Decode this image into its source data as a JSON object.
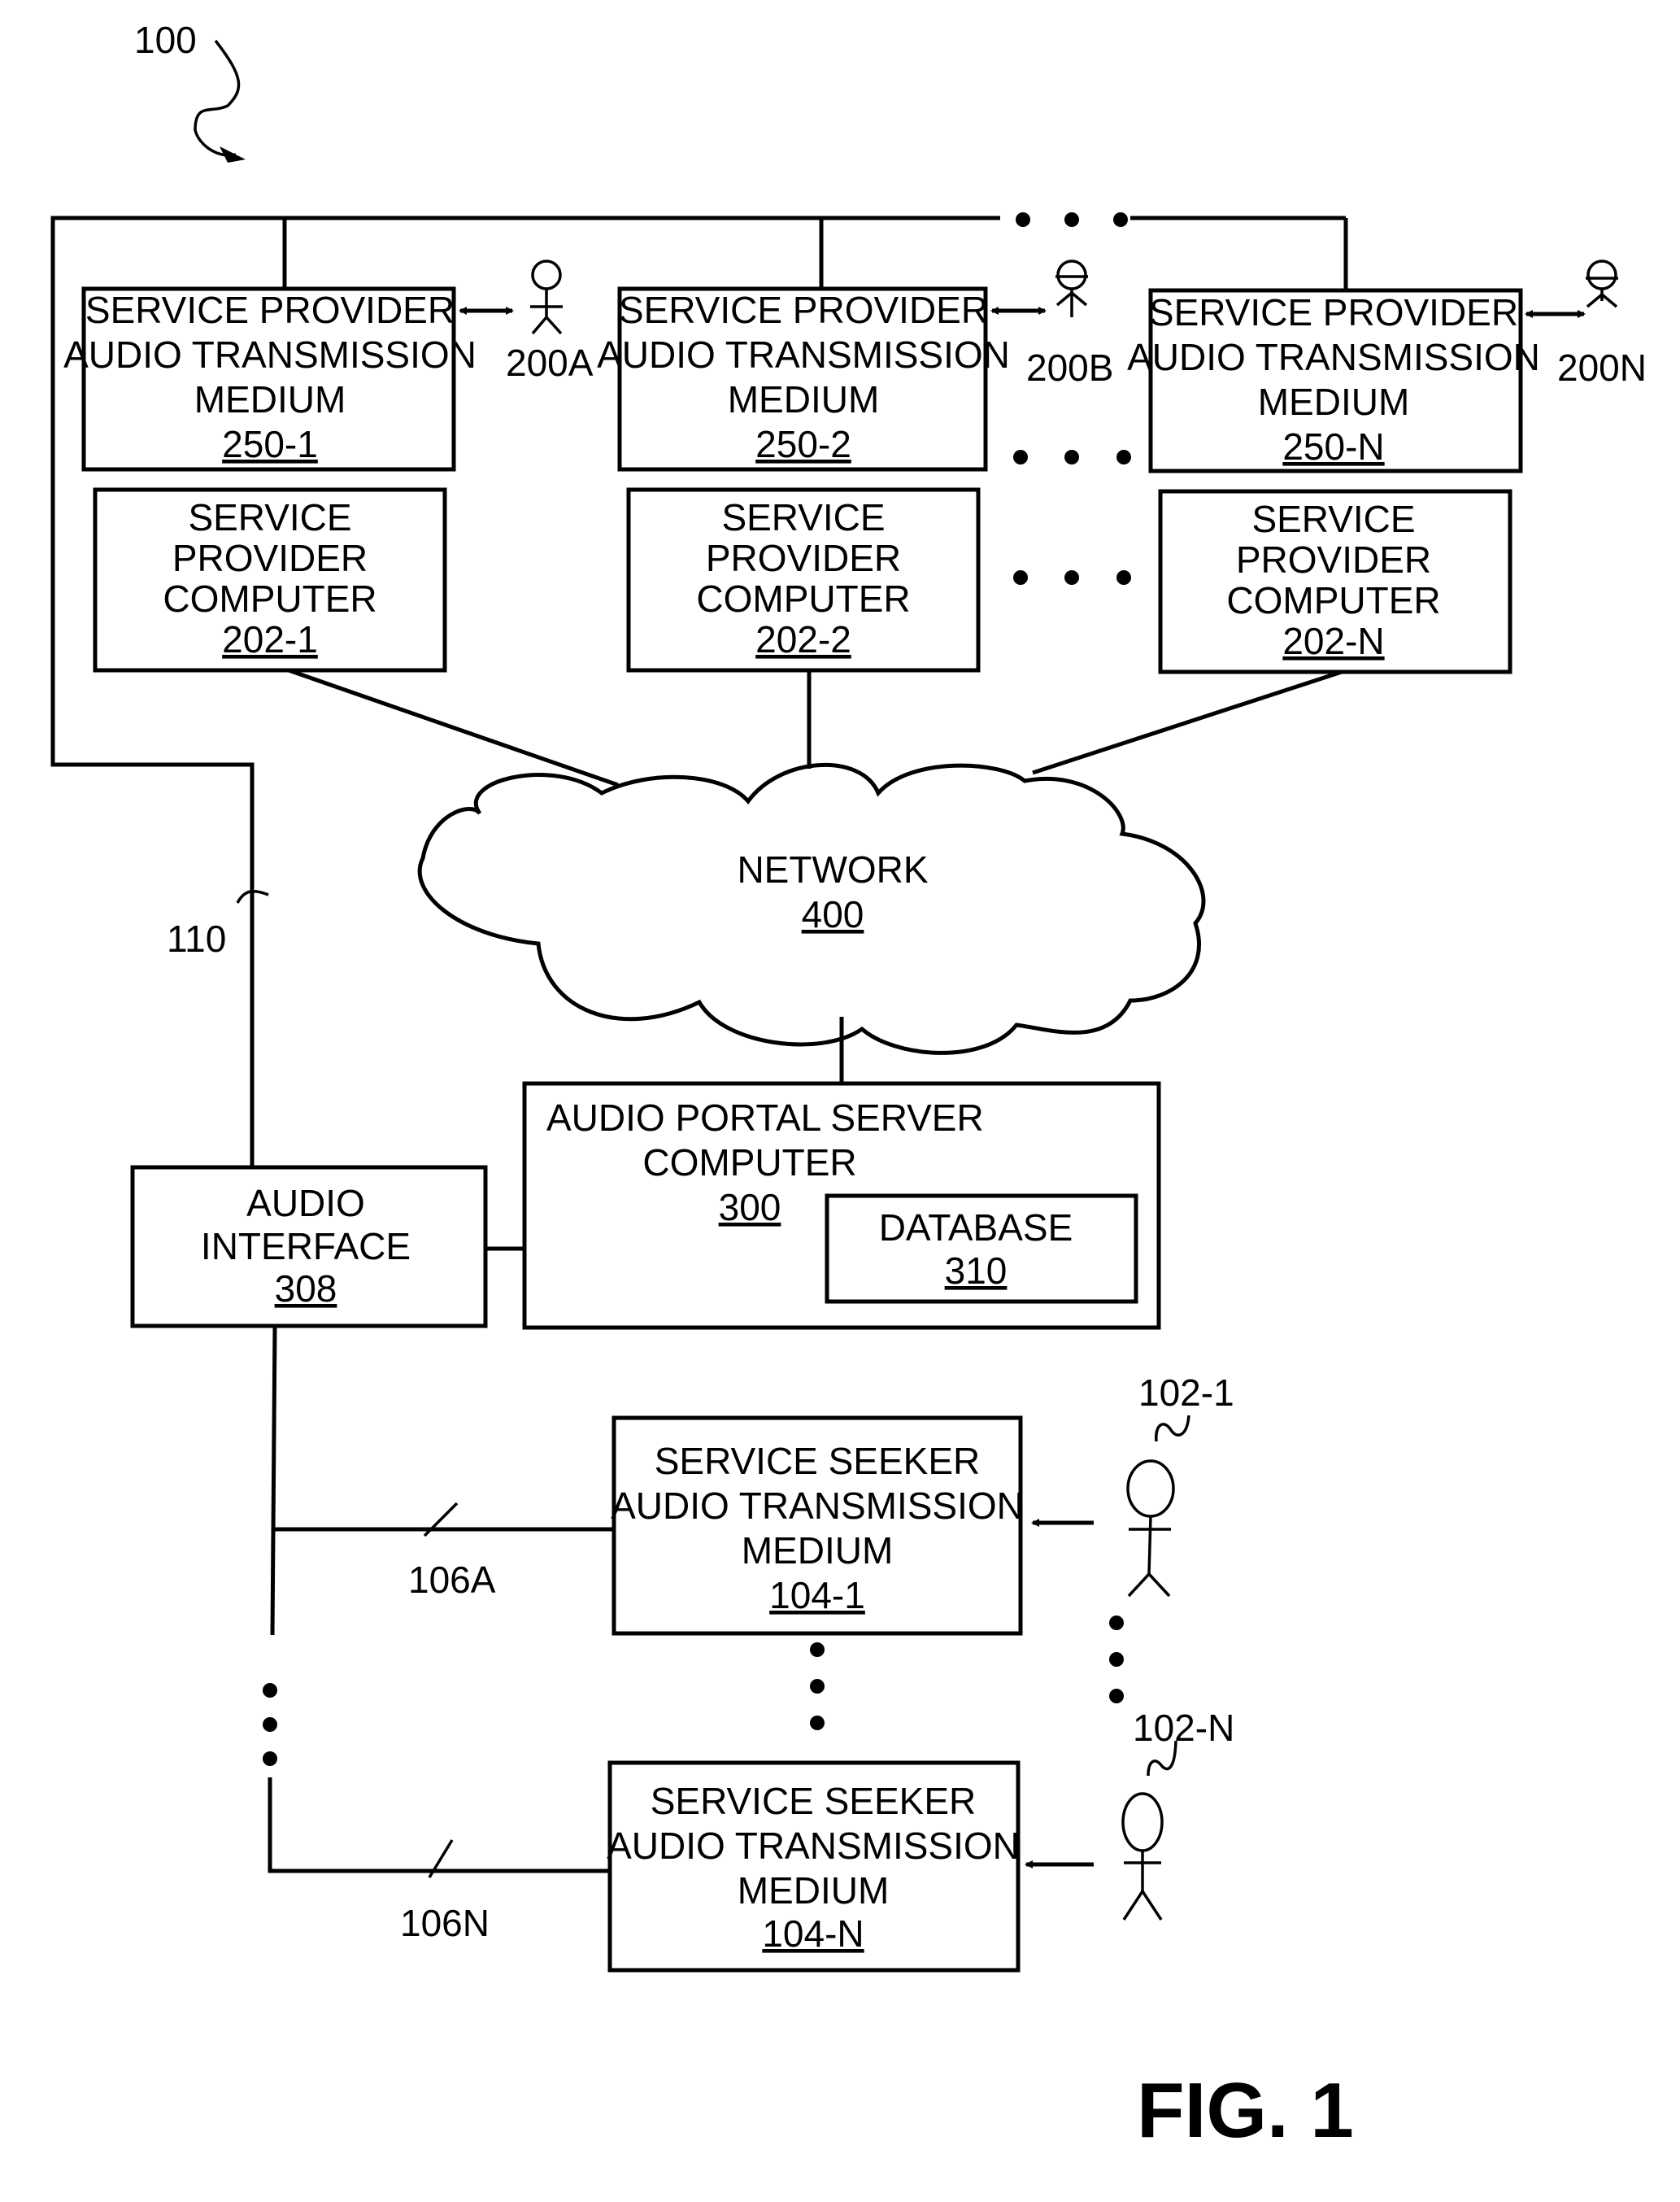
{
  "figure": {
    "label": "FIG. 1",
    "system_ref": "100",
    "bus_ref": "110"
  },
  "providers": [
    {
      "medium": {
        "lines": [
          "SERVICE PROVIDER",
          "AUDIO TRANSMISSION",
          "MEDIUM"
        ],
        "ref": "250-1"
      },
      "computer": {
        "lines": [
          "SERVICE",
          "PROVIDER",
          "COMPUTER"
        ],
        "ref": "202-1"
      },
      "person_ref": "200A"
    },
    {
      "medium": {
        "lines": [
          "SERVICE PROVIDER",
          "AUDIO TRANSMISSION",
          "MEDIUM"
        ],
        "ref": "250-2"
      },
      "computer": {
        "lines": [
          "SERVICE",
          "PROVIDER",
          "COMPUTER"
        ],
        "ref": "202-2"
      },
      "person_ref": "200B"
    },
    {
      "medium": {
        "lines": [
          "SERVICE PROVIDER",
          "AUDIO TRANSMISSION",
          "MEDIUM"
        ],
        "ref": "250-N"
      },
      "computer": {
        "lines": [
          "SERVICE",
          "PROVIDER",
          "COMPUTER"
        ],
        "ref": "202-N"
      },
      "person_ref": "200N"
    }
  ],
  "network": {
    "label": "NETWORK",
    "ref": "400"
  },
  "portal": {
    "lines": [
      "AUDIO PORTAL SERVER",
      "COMPUTER"
    ],
    "ref": "300",
    "database": {
      "label": "DATABASE",
      "ref": "310"
    }
  },
  "audio_interface": {
    "lines": [
      "AUDIO",
      "INTERFACE"
    ],
    "ref": "308"
  },
  "seekers": [
    {
      "medium": {
        "lines": [
          "SERVICE SEEKER",
          "AUDIO TRANSMISSION",
          "MEDIUM"
        ],
        "ref": "104-1"
      },
      "line_ref": "106A",
      "person_ref": "102-1"
    },
    {
      "medium": {
        "lines": [
          "SERVICE SEEKER",
          "AUDIO TRANSMISSION",
          "MEDIUM"
        ],
        "ref": "104-N"
      },
      "line_ref": "106N",
      "person_ref": "102-N"
    }
  ]
}
